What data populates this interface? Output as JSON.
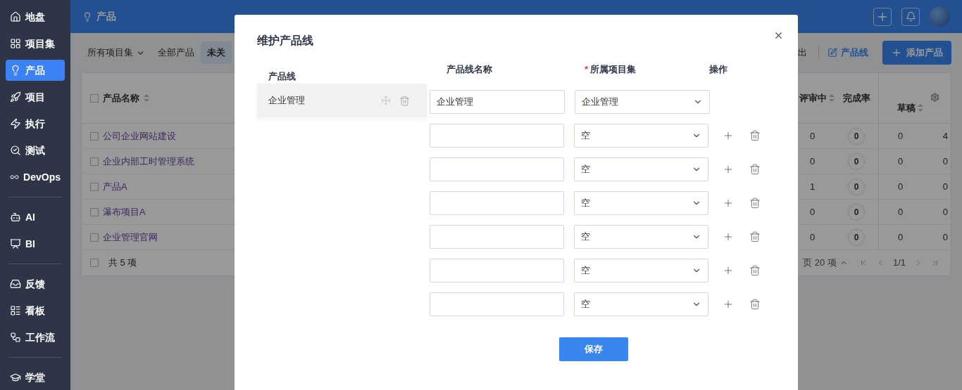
{
  "sidebar": {
    "groups": [
      {
        "items": [
          {
            "label": "地盘",
            "selected": false
          },
          {
            "label": "项目集",
            "selected": false
          },
          {
            "label": "产品",
            "selected": true
          },
          {
            "label": "项目",
            "selected": false
          },
          {
            "label": "执行",
            "selected": false
          },
          {
            "label": "测试",
            "selected": false
          },
          {
            "label": "DevOps",
            "selected": false
          }
        ]
      },
      {
        "items": [
          {
            "label": "AI",
            "selected": false
          },
          {
            "label": "BI",
            "selected": false
          }
        ]
      },
      {
        "items": [
          {
            "label": "反馈",
            "selected": false
          },
          {
            "label": "看板",
            "selected": false
          },
          {
            "label": "工作流",
            "selected": false
          }
        ]
      },
      {
        "items": [
          {
            "label": "学堂",
            "selected": false
          }
        ]
      }
    ]
  },
  "header": {
    "title": "产品"
  },
  "toolbar": {
    "filters": [
      {
        "label": "所有项目集",
        "kind": "dropdown",
        "selected": false
      },
      {
        "label": "全部产品",
        "kind": "tab",
        "selected": false
      },
      {
        "label": "未关",
        "kind": "tab",
        "selected": true
      }
    ],
    "export_label": "出",
    "product_line_label": "产品线",
    "add_label": "添加产品"
  },
  "table": {
    "header_checked": false,
    "footer_checked": false,
    "name_header": "产品名称",
    "right_headers": [
      "评审中",
      "完成率",
      "草稿"
    ],
    "rows": [
      {
        "checked": false,
        "name": "公司企业网站建设",
        "reviewing": "0",
        "completion": "0",
        "draft": "0",
        "column_5": "4"
      },
      {
        "checked": false,
        "name": "企业内部工时管理系统",
        "reviewing": "0",
        "completion": "0",
        "draft": "0",
        "column_5": "0"
      },
      {
        "checked": false,
        "name": "产品A",
        "reviewing": "1",
        "completion": "0",
        "draft": "0",
        "column_5": "0"
      },
      {
        "checked": false,
        "name": "瀑布项目A",
        "reviewing": "0",
        "completion": "0",
        "draft": "0",
        "column_5": "0"
      },
      {
        "checked": false,
        "name": "企业管理官网",
        "reviewing": "0",
        "completion": "0",
        "draft": "0",
        "column_5": "0"
      }
    ],
    "total": "共 5 项",
    "page_size": "页 20 项",
    "page": "1/1"
  },
  "dialog": {
    "title": "维护产品线",
    "list_header": "产品线",
    "lines": [
      {
        "label": "企业管理",
        "selected": true
      }
    ],
    "columns": [
      "产品线名称",
      "所属项目集",
      "操作"
    ],
    "required_mark": "*",
    "rows": [
      {
        "name": "企业管理",
        "project_set": "企业管理",
        "removable": false
      },
      {
        "project_set": "空",
        "removable": true
      },
      {
        "project_set": "空",
        "removable": true
      },
      {
        "project_set": "空",
        "removable": true
      },
      {
        "project_set": "空",
        "removable": true
      },
      {
        "project_set": "空",
        "removable": true
      },
      {
        "project_set": "空",
        "removable": true
      }
    ],
    "save_label": "保存"
  }
}
